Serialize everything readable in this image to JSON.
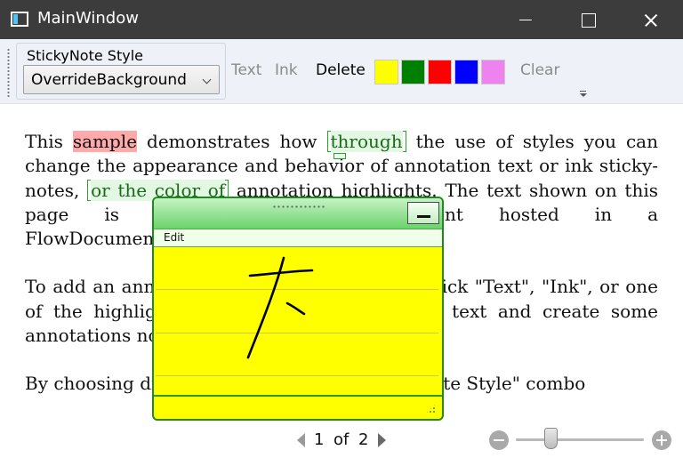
{
  "window": {
    "title": "MainWindow"
  },
  "toolbar": {
    "style_group_label": "StickyNote Style",
    "style_combo_value": "OverrideBackground",
    "text_label": "Text",
    "ink_label": "Ink",
    "delete_label": "Delete",
    "clear_label": "Clear",
    "highlight_colors": [
      "#ffff00",
      "#008000",
      "#ff0000",
      "#0000ff",
      "#ee82ee"
    ]
  },
  "document": {
    "p1": {
      "a": "This ",
      "h1": "sample",
      "b": " demonstrates how ",
      "h2": "through",
      "c": " the use of styles you can change the appearance and behavior of annotation text or ink sticky-notes, ",
      "h3": "or the color of",
      "d": " annotation highlights. The text shown on this page is part of a FlowDocument hosted in a FlowDocumentPageViewer."
    },
    "p2": "To add an annotation, select some text and click \"Text\", \"Ink\", or one of the highlight colors. Select some of the text and create some annotations now.",
    "p3": "By choosing different options in the \"StickyNote Style\" combo"
  },
  "sticky_note": {
    "menu_label": "Edit",
    "background": "#ffff00",
    "border": "#1f8a1f"
  },
  "pager": {
    "current": "1",
    "of_label": "of",
    "total": "2"
  },
  "zoom": {
    "level": 0.25
  }
}
